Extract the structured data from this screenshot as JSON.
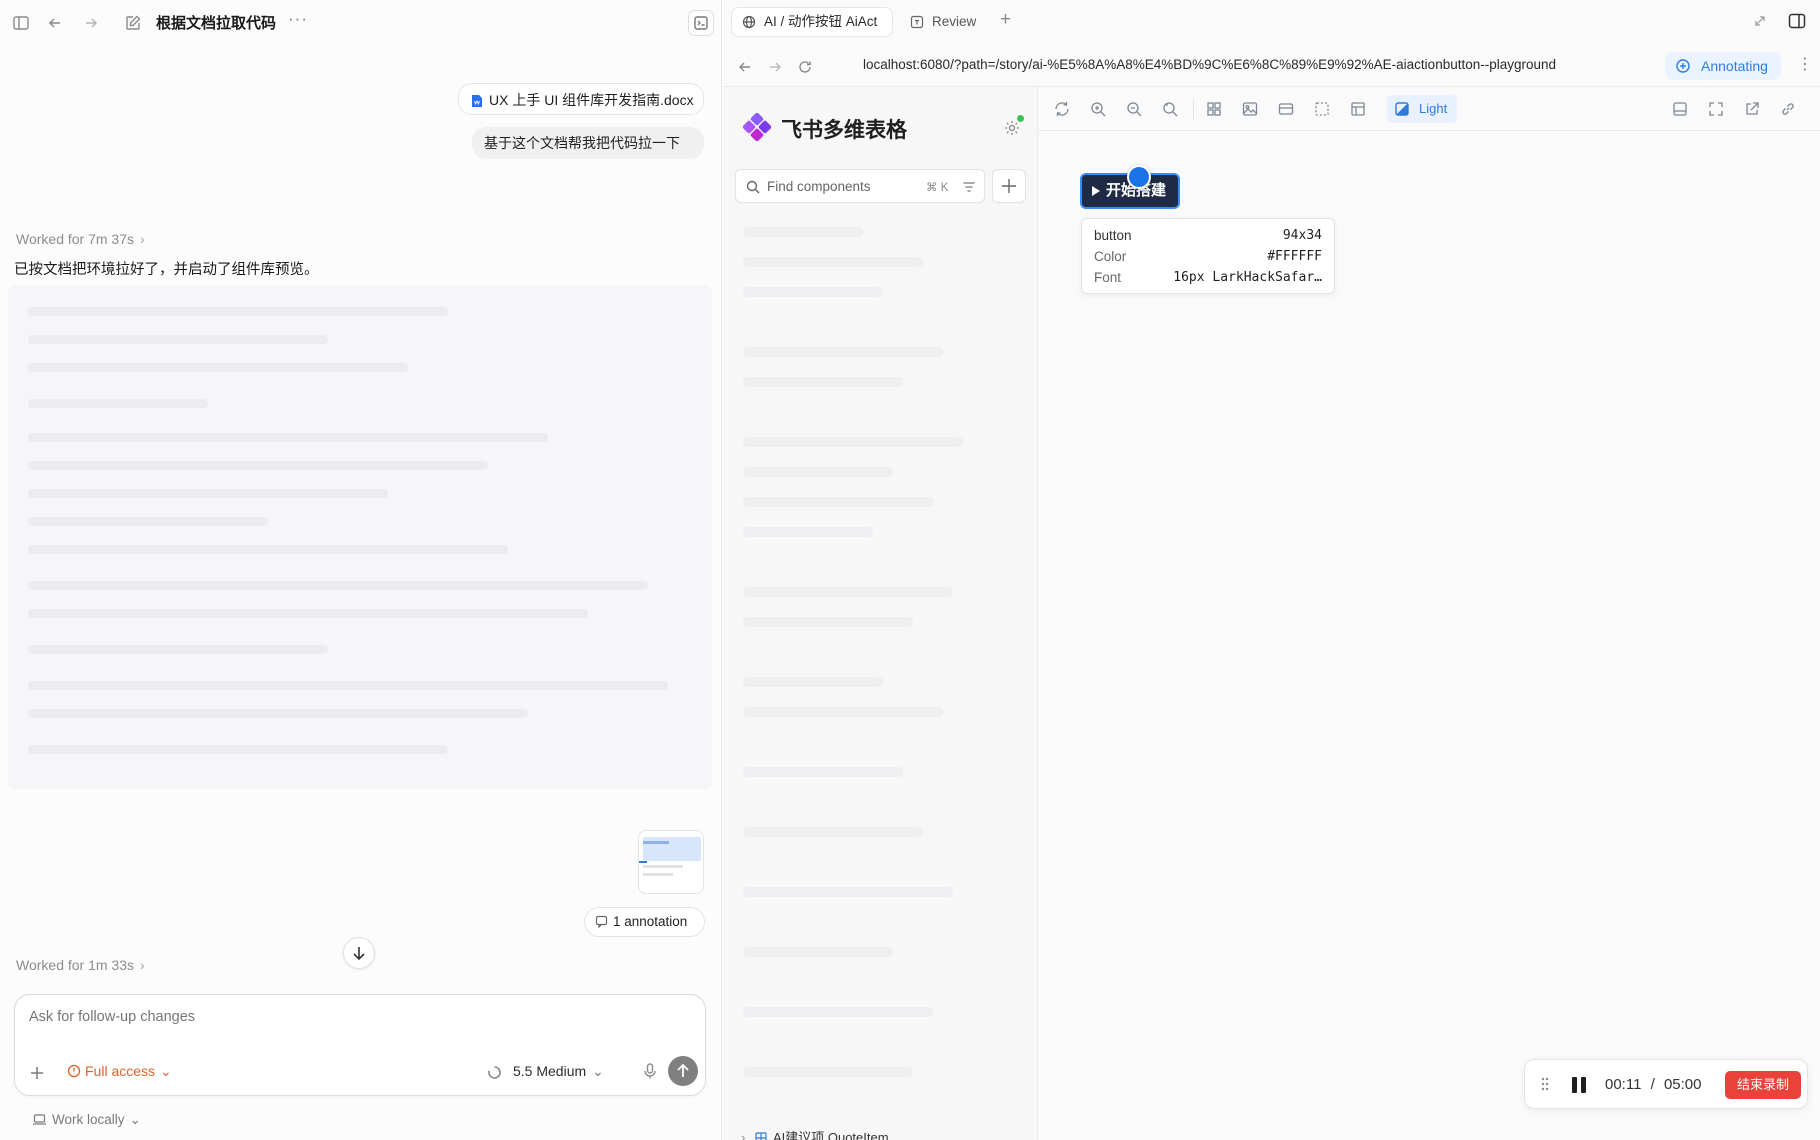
{
  "left": {
    "title": "根据文档拉取代码",
    "more": "···",
    "attachment_name": "UX 上手 UI 组件库开发指南.docx",
    "user_message": "基于这个文档帮我把代码拉一下",
    "worked_1": "Worked for 7m 37s",
    "response": "已按文档把环境拉好了，并启动了组件库预览。",
    "annotation_label": "1 annotation",
    "worked_2": "Worked for 1m 33s",
    "composer_placeholder": "Ask for follow-up changes",
    "full_access": "Full access",
    "model": "5.5 Medium",
    "work_locally": "Work locally"
  },
  "right": {
    "tab_active": "AI / 动作按钮 AiAct",
    "tab_review": "Review",
    "url": "localhost:6080/?path=/story/ai-%E5%8A%A8%E4%BD%9C%E6%8C%89%E9%92%AE-aiactionbutton--playground",
    "annotating": "Annotating",
    "brand": "飞书多维表格",
    "search_placeholder": "Find components",
    "search_shortcut": "⌘ K",
    "light_label": "Light",
    "preview_button_label": "开始搭建",
    "inspect": {
      "element": "button",
      "size": "94x34",
      "color_label": "Color",
      "color_value": "#FFFFFF",
      "font_label": "Font",
      "font_value": "16px LarkHackSafar…"
    },
    "sidebar_bottom_item": "AI建议项 QuoteItem",
    "recording": {
      "elapsed": "00:11",
      "separator": "/",
      "total": "05:00",
      "stop_label": "结束录制"
    }
  },
  "colors": {
    "accent_blue": "#2f7ad8",
    "warning_orange": "#e0622a",
    "record_red": "#e8423b",
    "preview_button_bg": "#1f2a44"
  }
}
